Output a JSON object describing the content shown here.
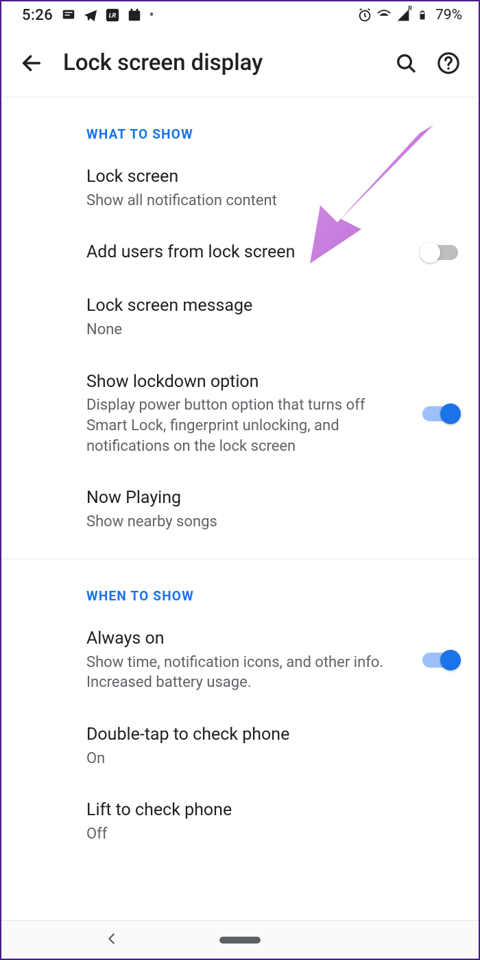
{
  "statusBar": {
    "time": "5:26",
    "battery": "79%"
  },
  "appBar": {
    "title": "Lock screen display"
  },
  "sections": {
    "whatToShow": {
      "header": "WHAT TO SHOW",
      "lockScreen": {
        "title": "Lock screen",
        "subtitle": "Show all notification content"
      },
      "addUsers": {
        "title": "Add users from lock screen"
      },
      "lockScreenMessage": {
        "title": "Lock screen message",
        "subtitle": "None"
      },
      "showLockdown": {
        "title": "Show lockdown option",
        "subtitle": "Display power button option that turns off Smart Lock, fingerprint unlocking, and notifications on the lock screen"
      },
      "nowPlaying": {
        "title": "Now Playing",
        "subtitle": "Show nearby songs"
      }
    },
    "whenToShow": {
      "header": "WHEN TO SHOW",
      "alwaysOn": {
        "title": "Always on",
        "subtitle": "Show time, notification icons, and other info. Increased battery usage."
      },
      "doubleTap": {
        "title": "Double-tap to check phone",
        "subtitle": "On"
      },
      "lift": {
        "title": "Lift to check phone",
        "subtitle": "Off"
      }
    }
  }
}
